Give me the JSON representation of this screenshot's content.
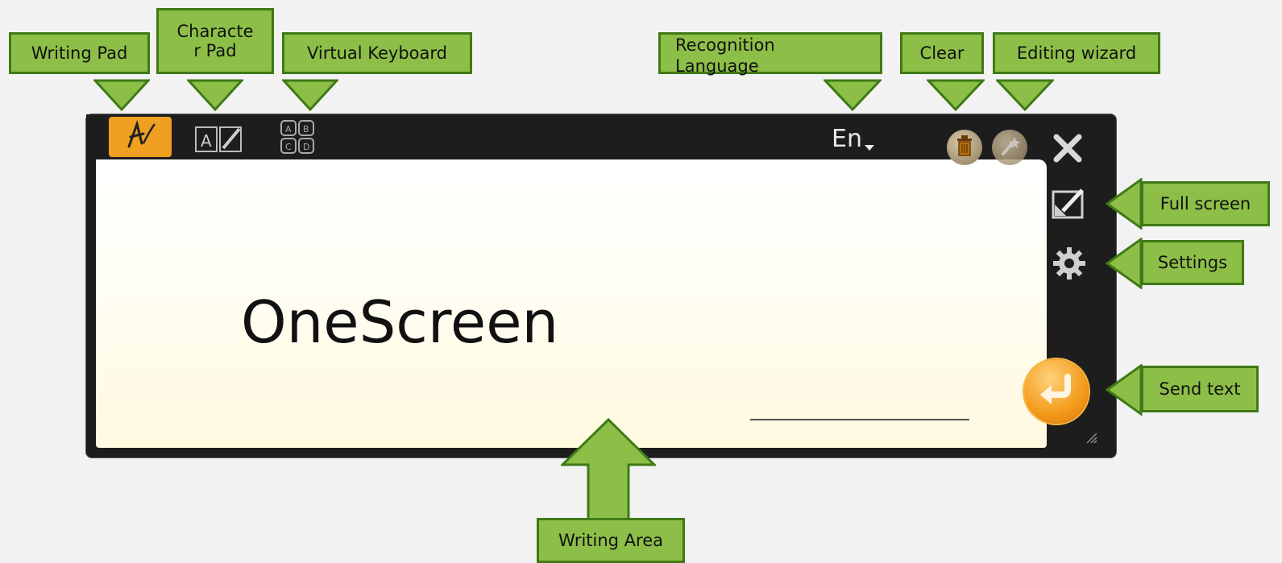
{
  "callouts": {
    "writing_pad": "Writing Pad",
    "character_pad": "Characte\nr Pad",
    "virtual_keyboard": "Virtual Keyboard",
    "recognition_language": "Recognition\nLanguage",
    "clear": "Clear",
    "editing_wizard": "Editing wizard",
    "full_screen": "Full screen",
    "settings": "Settings",
    "send_text": "Send text",
    "writing_area": "Writing Area"
  },
  "panel": {
    "language": "En",
    "recognized_text": "OneScreen"
  },
  "colors": {
    "callout_fill": "#8dbf48",
    "callout_border": "#3f7a16",
    "window_bg": "#1d1d1d",
    "active_tool": "#f0a020",
    "send_button": "#f39a1a"
  },
  "icons": {
    "writing_pad": "handwriting-icon",
    "character_pad": "character-pad-icon",
    "virtual_keyboard": "keyboard-abcd-icon",
    "clear": "trash-icon",
    "editing_wizard": "wand-icon",
    "close": "close-icon",
    "full_screen": "fullscreen-icon",
    "settings": "gear-icon",
    "send_text": "enter-arrow-icon"
  }
}
